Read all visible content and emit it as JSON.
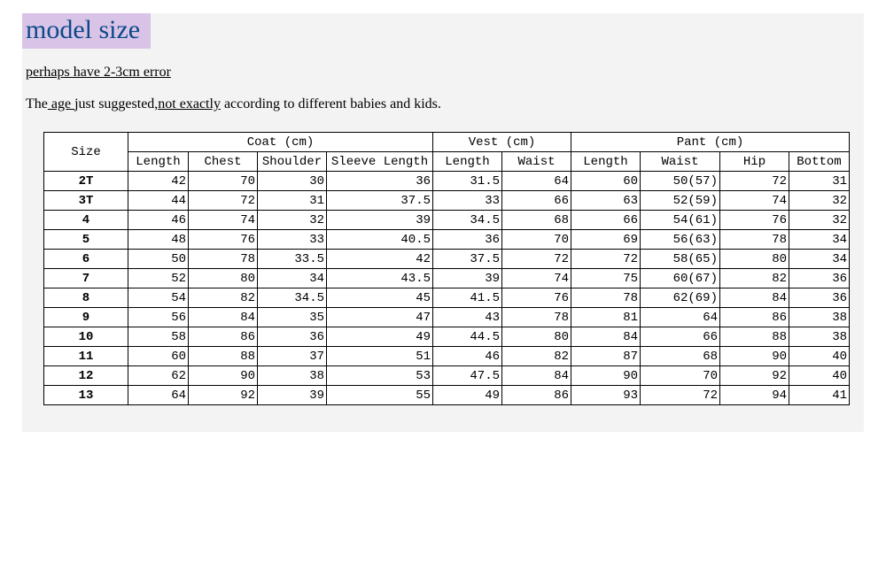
{
  "title": "model size",
  "subtitle": "perhaps have 2-3cm error",
  "note_prefix": "The",
  "note_age": " age ",
  "note_mid": "just suggested,",
  "note_not_exactly": "not exactly",
  "note_suffix": " according to different babies and kids.",
  "headers": {
    "size": "Size",
    "coat": "Coat (cm)",
    "vest": "Vest (cm)",
    "pant": "Pant (cm)",
    "coat_length": "Length",
    "coat_chest": "Chest",
    "coat_shoulder": "Shoulder",
    "coat_sleeve": "Sleeve Length",
    "vest_length": "Length",
    "vest_waist": "Waist",
    "pant_length": "Length",
    "pant_waist": "Waist",
    "pant_hip": "Hip",
    "pant_bottom": "Bottom"
  },
  "rows": [
    {
      "size": "2T",
      "coat_length": "42",
      "coat_chest": "70",
      "coat_shoulder": "30",
      "coat_sleeve": "36",
      "vest_length": "31.5",
      "vest_waist": "64",
      "pant_length": "60",
      "pant_waist": "50(57)",
      "pant_hip": "72",
      "pant_bottom": "31"
    },
    {
      "size": "3T",
      "coat_length": "44",
      "coat_chest": "72",
      "coat_shoulder": "31",
      "coat_sleeve": "37.5",
      "vest_length": "33",
      "vest_waist": "66",
      "pant_length": "63",
      "pant_waist": "52(59)",
      "pant_hip": "74",
      "pant_bottom": "32"
    },
    {
      "size": "4",
      "coat_length": "46",
      "coat_chest": "74",
      "coat_shoulder": "32",
      "coat_sleeve": "39",
      "vest_length": "34.5",
      "vest_waist": "68",
      "pant_length": "66",
      "pant_waist": "54(61)",
      "pant_hip": "76",
      "pant_bottom": "32"
    },
    {
      "size": "5",
      "coat_length": "48",
      "coat_chest": "76",
      "coat_shoulder": "33",
      "coat_sleeve": "40.5",
      "vest_length": "36",
      "vest_waist": "70",
      "pant_length": "69",
      "pant_waist": "56(63)",
      "pant_hip": "78",
      "pant_bottom": "34"
    },
    {
      "size": "6",
      "coat_length": "50",
      "coat_chest": "78",
      "coat_shoulder": "33.5",
      "coat_sleeve": "42",
      "vest_length": "37.5",
      "vest_waist": "72",
      "pant_length": "72",
      "pant_waist": "58(65)",
      "pant_hip": "80",
      "pant_bottom": "34"
    },
    {
      "size": "7",
      "coat_length": "52",
      "coat_chest": "80",
      "coat_shoulder": "34",
      "coat_sleeve": "43.5",
      "vest_length": "39",
      "vest_waist": "74",
      "pant_length": "75",
      "pant_waist": "60(67)",
      "pant_hip": "82",
      "pant_bottom": "36"
    },
    {
      "size": "8",
      "coat_length": "54",
      "coat_chest": "82",
      "coat_shoulder": "34.5",
      "coat_sleeve": "45",
      "vest_length": "41.5",
      "vest_waist": "76",
      "pant_length": "78",
      "pant_waist": "62(69)",
      "pant_hip": "84",
      "pant_bottom": "36"
    },
    {
      "size": "9",
      "coat_length": "56",
      "coat_chest": "84",
      "coat_shoulder": "35",
      "coat_sleeve": "47",
      "vest_length": "43",
      "vest_waist": "78",
      "pant_length": "81",
      "pant_waist": "64",
      "pant_hip": "86",
      "pant_bottom": "38"
    },
    {
      "size": "10",
      "coat_length": "58",
      "coat_chest": "86",
      "coat_shoulder": "36",
      "coat_sleeve": "49",
      "vest_length": "44.5",
      "vest_waist": "80",
      "pant_length": "84",
      "pant_waist": "66",
      "pant_hip": "88",
      "pant_bottom": "38"
    },
    {
      "size": "11",
      "coat_length": "60",
      "coat_chest": "88",
      "coat_shoulder": "37",
      "coat_sleeve": "51",
      "vest_length": "46",
      "vest_waist": "82",
      "pant_length": "87",
      "pant_waist": "68",
      "pant_hip": "90",
      "pant_bottom": "40"
    },
    {
      "size": "12",
      "coat_length": "62",
      "coat_chest": "90",
      "coat_shoulder": "38",
      "coat_sleeve": "53",
      "vest_length": "47.5",
      "vest_waist": "84",
      "pant_length": "90",
      "pant_waist": "70",
      "pant_hip": "92",
      "pant_bottom": "40"
    },
    {
      "size": "13",
      "coat_length": "64",
      "coat_chest": "92",
      "coat_shoulder": "39",
      "coat_sleeve": "55",
      "vest_length": "49",
      "vest_waist": "86",
      "pant_length": "93",
      "pant_waist": "72",
      "pant_hip": "94",
      "pant_bottom": "41"
    }
  ]
}
